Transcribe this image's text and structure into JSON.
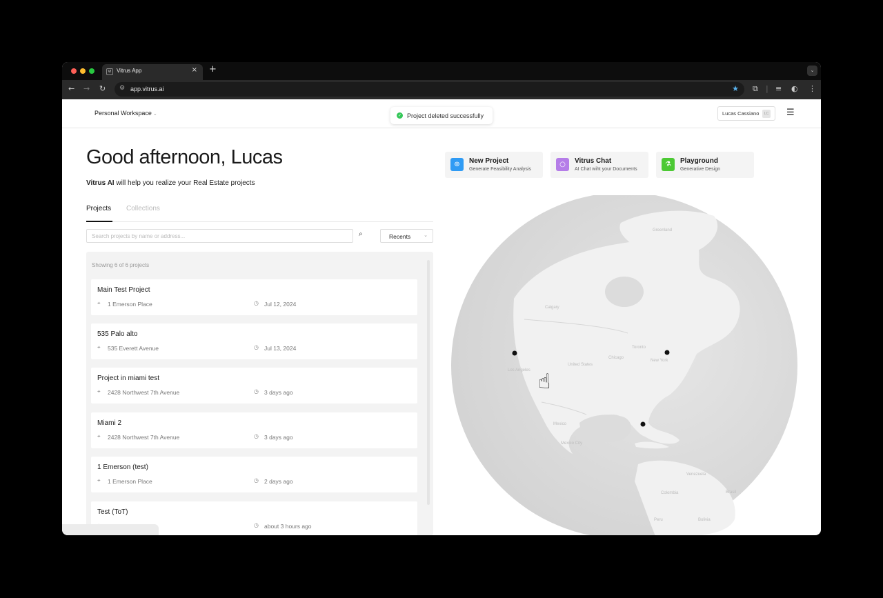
{
  "browser": {
    "tab_favicon": "VI",
    "tab_title": "Vitrus App",
    "tab_close": "×",
    "new_tab": "+",
    "tab_menu": "⌄",
    "url": "app.vitrus.ai",
    "accent_color": "#5ab4f0"
  },
  "header": {
    "workspace": "Personal Workspace",
    "toast": "Project deleted successfully",
    "user_name": "Lucas Cassiano",
    "user_avatar": "LC"
  },
  "hero": {
    "greeting": "Good afternoon, Lucas",
    "subtitle_brand": "Vitrus AI",
    "subtitle_rest": " will help you realize your Real Estate projects"
  },
  "tabs": {
    "projects": "Projects",
    "collections": "Collections"
  },
  "search": {
    "placeholder": "Search projects by name or address..."
  },
  "sort": {
    "label": "Recents"
  },
  "list": {
    "showing": "Showing 6 of 6 projects",
    "projects": [
      {
        "title": "Main Test Project",
        "address": "1 Emerson Place",
        "date": "Jul 12, 2024"
      },
      {
        "title": "535 Palo alto",
        "address": "535 Everett Avenue",
        "date": "Jul 13, 2024"
      },
      {
        "title": "Project in miami test",
        "address": "2428 Northwest 7th Avenue",
        "date": "3 days ago"
      },
      {
        "title": "Miami 2",
        "address": "2428 Northwest 7th Avenue",
        "date": "3 days ago"
      },
      {
        "title": "1 Emerson (test)",
        "address": "1 Emerson Place",
        "date": "2 days ago"
      },
      {
        "title": "Test (ToT)",
        "address": "",
        "date": "about 3 hours ago"
      }
    ]
  },
  "actions": [
    {
      "title": "New Project",
      "subtitle": "Generate Feasibility Analysis",
      "color": "#2f9bf4",
      "icon": "plus-circle-icon"
    },
    {
      "title": "Vitrus Chat",
      "subtitle": "AI Chat wiht your Documents",
      "color": "#b57de8",
      "icon": "chat-bubble-icon"
    },
    {
      "title": "Playground",
      "subtitle": "Generative Design",
      "color": "#4cc934",
      "icon": "flask-icon"
    }
  ],
  "map": {
    "labels": [
      "Greenland",
      "Calgary",
      "Chicago",
      "Toronto",
      "New York",
      "United States",
      "Los Angeles",
      "Mexico",
      "Mexico City",
      "Venezuela",
      "Colombia",
      "Peru",
      "Brasil",
      "Bolivia"
    ]
  }
}
